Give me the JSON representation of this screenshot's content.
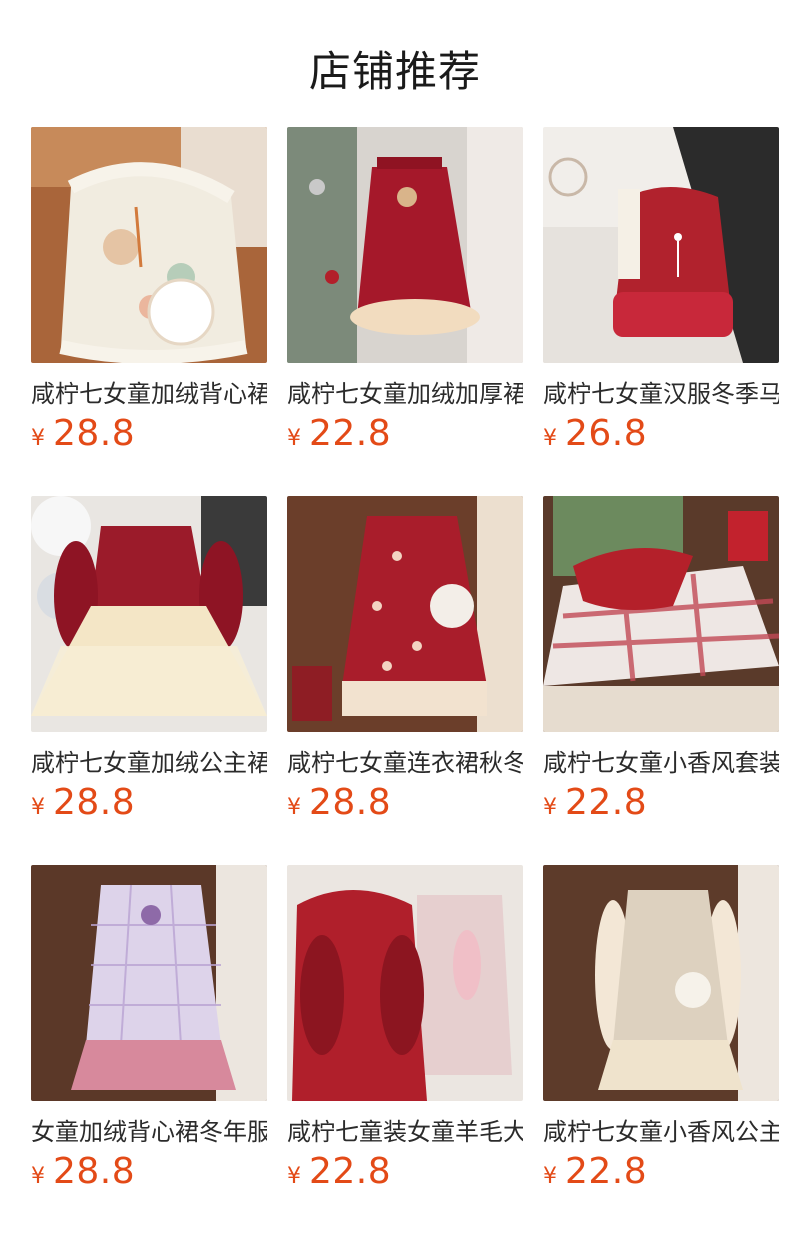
{
  "header": {
    "title": "店铺推荐"
  },
  "products": [
    {
      "name": "咸柠七女童加绒背心裙冬季",
      "currency": "¥",
      "price": "28.8",
      "image_icon": "floral-qipao-vest-photo"
    },
    {
      "name": "咸柠七女童加绒加厚裙",
      "currency": "¥",
      "price": "22.8",
      "image_icon": "red-sequin-dress-photo"
    },
    {
      "name": "咸柠七女童汉服冬季马甲",
      "currency": "¥",
      "price": "26.8",
      "image_icon": "red-vest-dress-photo"
    },
    {
      "name": "咸柠七女童加绒公主裙",
      "currency": "¥",
      "price": "28.8",
      "image_icon": "velvet-tulle-dress-photo"
    },
    {
      "name": "咸柠七女童连衣裙秋冬",
      "currency": "¥",
      "price": "28.8",
      "image_icon": "red-bow-dress-photo"
    },
    {
      "name": "咸柠七女童小香风套装",
      "currency": "¥",
      "price": "22.8",
      "image_icon": "plaid-cape-coat-photo"
    },
    {
      "name": "女童加绒背心裙冬年服",
      "currency": "¥",
      "price": "28.8",
      "image_icon": "purple-tweed-vest-photo"
    },
    {
      "name": "咸柠七童装女童羊毛大衣",
      "currency": "¥",
      "price": "22.8",
      "image_icon": "red-hooded-coat-photo"
    },
    {
      "name": "咸柠七女童小香风公主裙",
      "currency": "¥",
      "price": "22.8",
      "image_icon": "cream-tweed-dress-photo"
    }
  ]
}
